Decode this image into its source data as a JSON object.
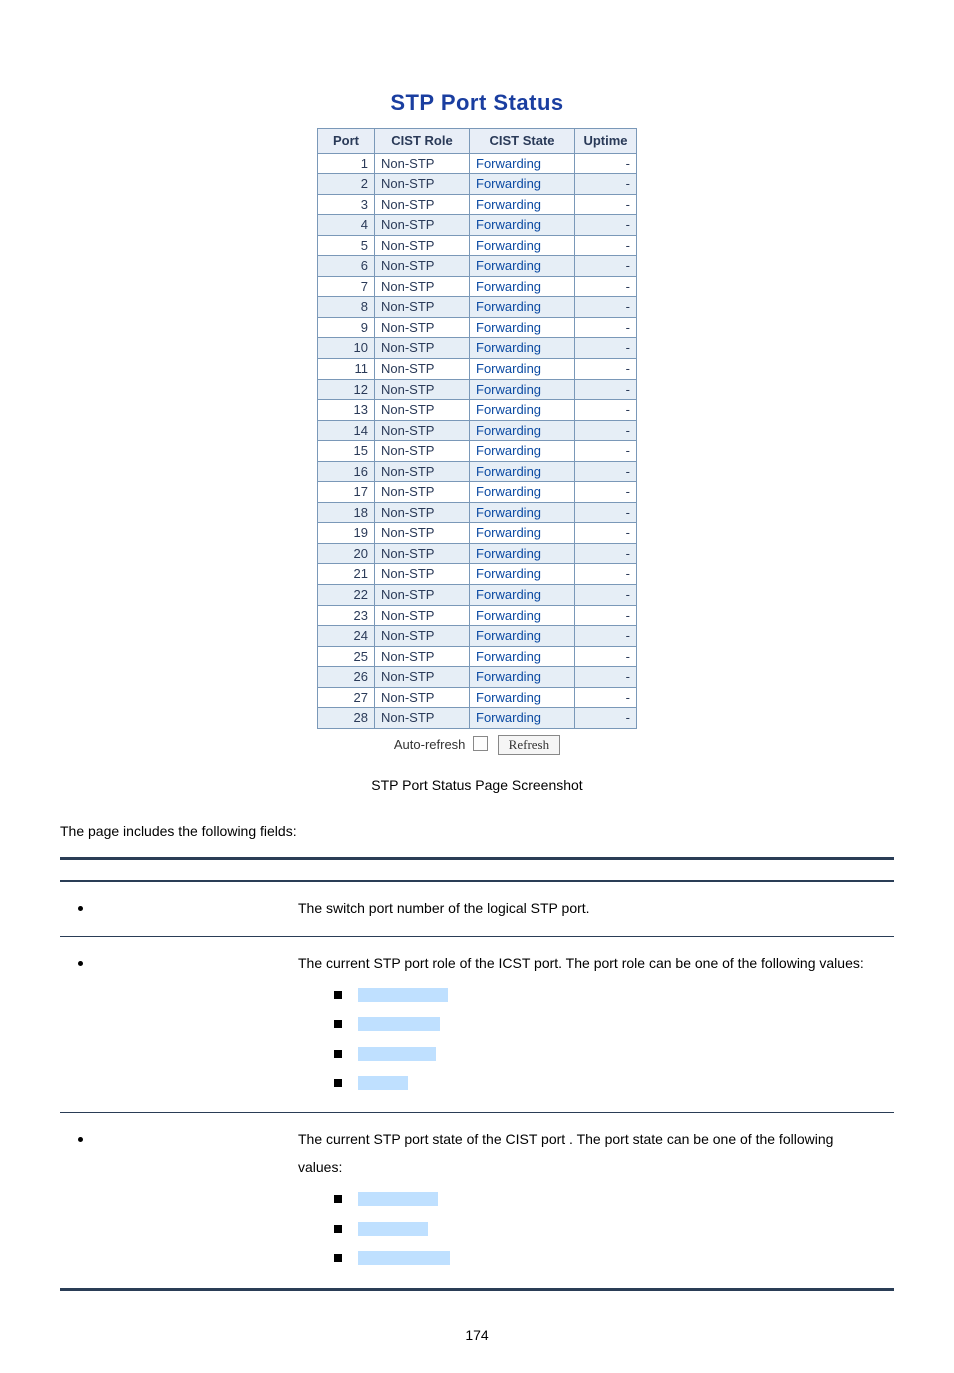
{
  "title": "STP Port Status",
  "columns": {
    "c0": "Port",
    "c1": "CIST Role",
    "c2": "CIST State",
    "c3": "Uptime"
  },
  "rows": [
    {
      "port": "1",
      "role": "Non-STP",
      "state": "Forwarding",
      "uptime": "-"
    },
    {
      "port": "2",
      "role": "Non-STP",
      "state": "Forwarding",
      "uptime": "-"
    },
    {
      "port": "3",
      "role": "Non-STP",
      "state": "Forwarding",
      "uptime": "-"
    },
    {
      "port": "4",
      "role": "Non-STP",
      "state": "Forwarding",
      "uptime": "-"
    },
    {
      "port": "5",
      "role": "Non-STP",
      "state": "Forwarding",
      "uptime": "-"
    },
    {
      "port": "6",
      "role": "Non-STP",
      "state": "Forwarding",
      "uptime": "-"
    },
    {
      "port": "7",
      "role": "Non-STP",
      "state": "Forwarding",
      "uptime": "-"
    },
    {
      "port": "8",
      "role": "Non-STP",
      "state": "Forwarding",
      "uptime": "-"
    },
    {
      "port": "9",
      "role": "Non-STP",
      "state": "Forwarding",
      "uptime": "-"
    },
    {
      "port": "10",
      "role": "Non-STP",
      "state": "Forwarding",
      "uptime": "-"
    },
    {
      "port": "11",
      "role": "Non-STP",
      "state": "Forwarding",
      "uptime": "-"
    },
    {
      "port": "12",
      "role": "Non-STP",
      "state": "Forwarding",
      "uptime": "-"
    },
    {
      "port": "13",
      "role": "Non-STP",
      "state": "Forwarding",
      "uptime": "-"
    },
    {
      "port": "14",
      "role": "Non-STP",
      "state": "Forwarding",
      "uptime": "-"
    },
    {
      "port": "15",
      "role": "Non-STP",
      "state": "Forwarding",
      "uptime": "-"
    },
    {
      "port": "16",
      "role": "Non-STP",
      "state": "Forwarding",
      "uptime": "-"
    },
    {
      "port": "17",
      "role": "Non-STP",
      "state": "Forwarding",
      "uptime": "-"
    },
    {
      "port": "18",
      "role": "Non-STP",
      "state": "Forwarding",
      "uptime": "-"
    },
    {
      "port": "19",
      "role": "Non-STP",
      "state": "Forwarding",
      "uptime": "-"
    },
    {
      "port": "20",
      "role": "Non-STP",
      "state": "Forwarding",
      "uptime": "-"
    },
    {
      "port": "21",
      "role": "Non-STP",
      "state": "Forwarding",
      "uptime": "-"
    },
    {
      "port": "22",
      "role": "Non-STP",
      "state": "Forwarding",
      "uptime": "-"
    },
    {
      "port": "23",
      "role": "Non-STP",
      "state": "Forwarding",
      "uptime": "-"
    },
    {
      "port": "24",
      "role": "Non-STP",
      "state": "Forwarding",
      "uptime": "-"
    },
    {
      "port": "25",
      "role": "Non-STP",
      "state": "Forwarding",
      "uptime": "-"
    },
    {
      "port": "26",
      "role": "Non-STP",
      "state": "Forwarding",
      "uptime": "-"
    },
    {
      "port": "27",
      "role": "Non-STP",
      "state": "Forwarding",
      "uptime": "-"
    },
    {
      "port": "28",
      "role": "Non-STP",
      "state": "Forwarding",
      "uptime": "-"
    }
  ],
  "auto_refresh_label": "Auto-refresh",
  "refresh_label": "Refresh",
  "caption": "STP Port Status Page Screenshot",
  "intro": "The page includes the following fields:",
  "desc": {
    "rows": [
      {
        "text": "The switch port number of the logical STP port."
      },
      {
        "text": "The current STP port role of the ICST port. The port role can be one of the following values:",
        "values": 4
      },
      {
        "text": "The current STP port state of the CIST port . The port state can be one of the following values:",
        "values": 3
      }
    ]
  },
  "page_number": "174"
}
